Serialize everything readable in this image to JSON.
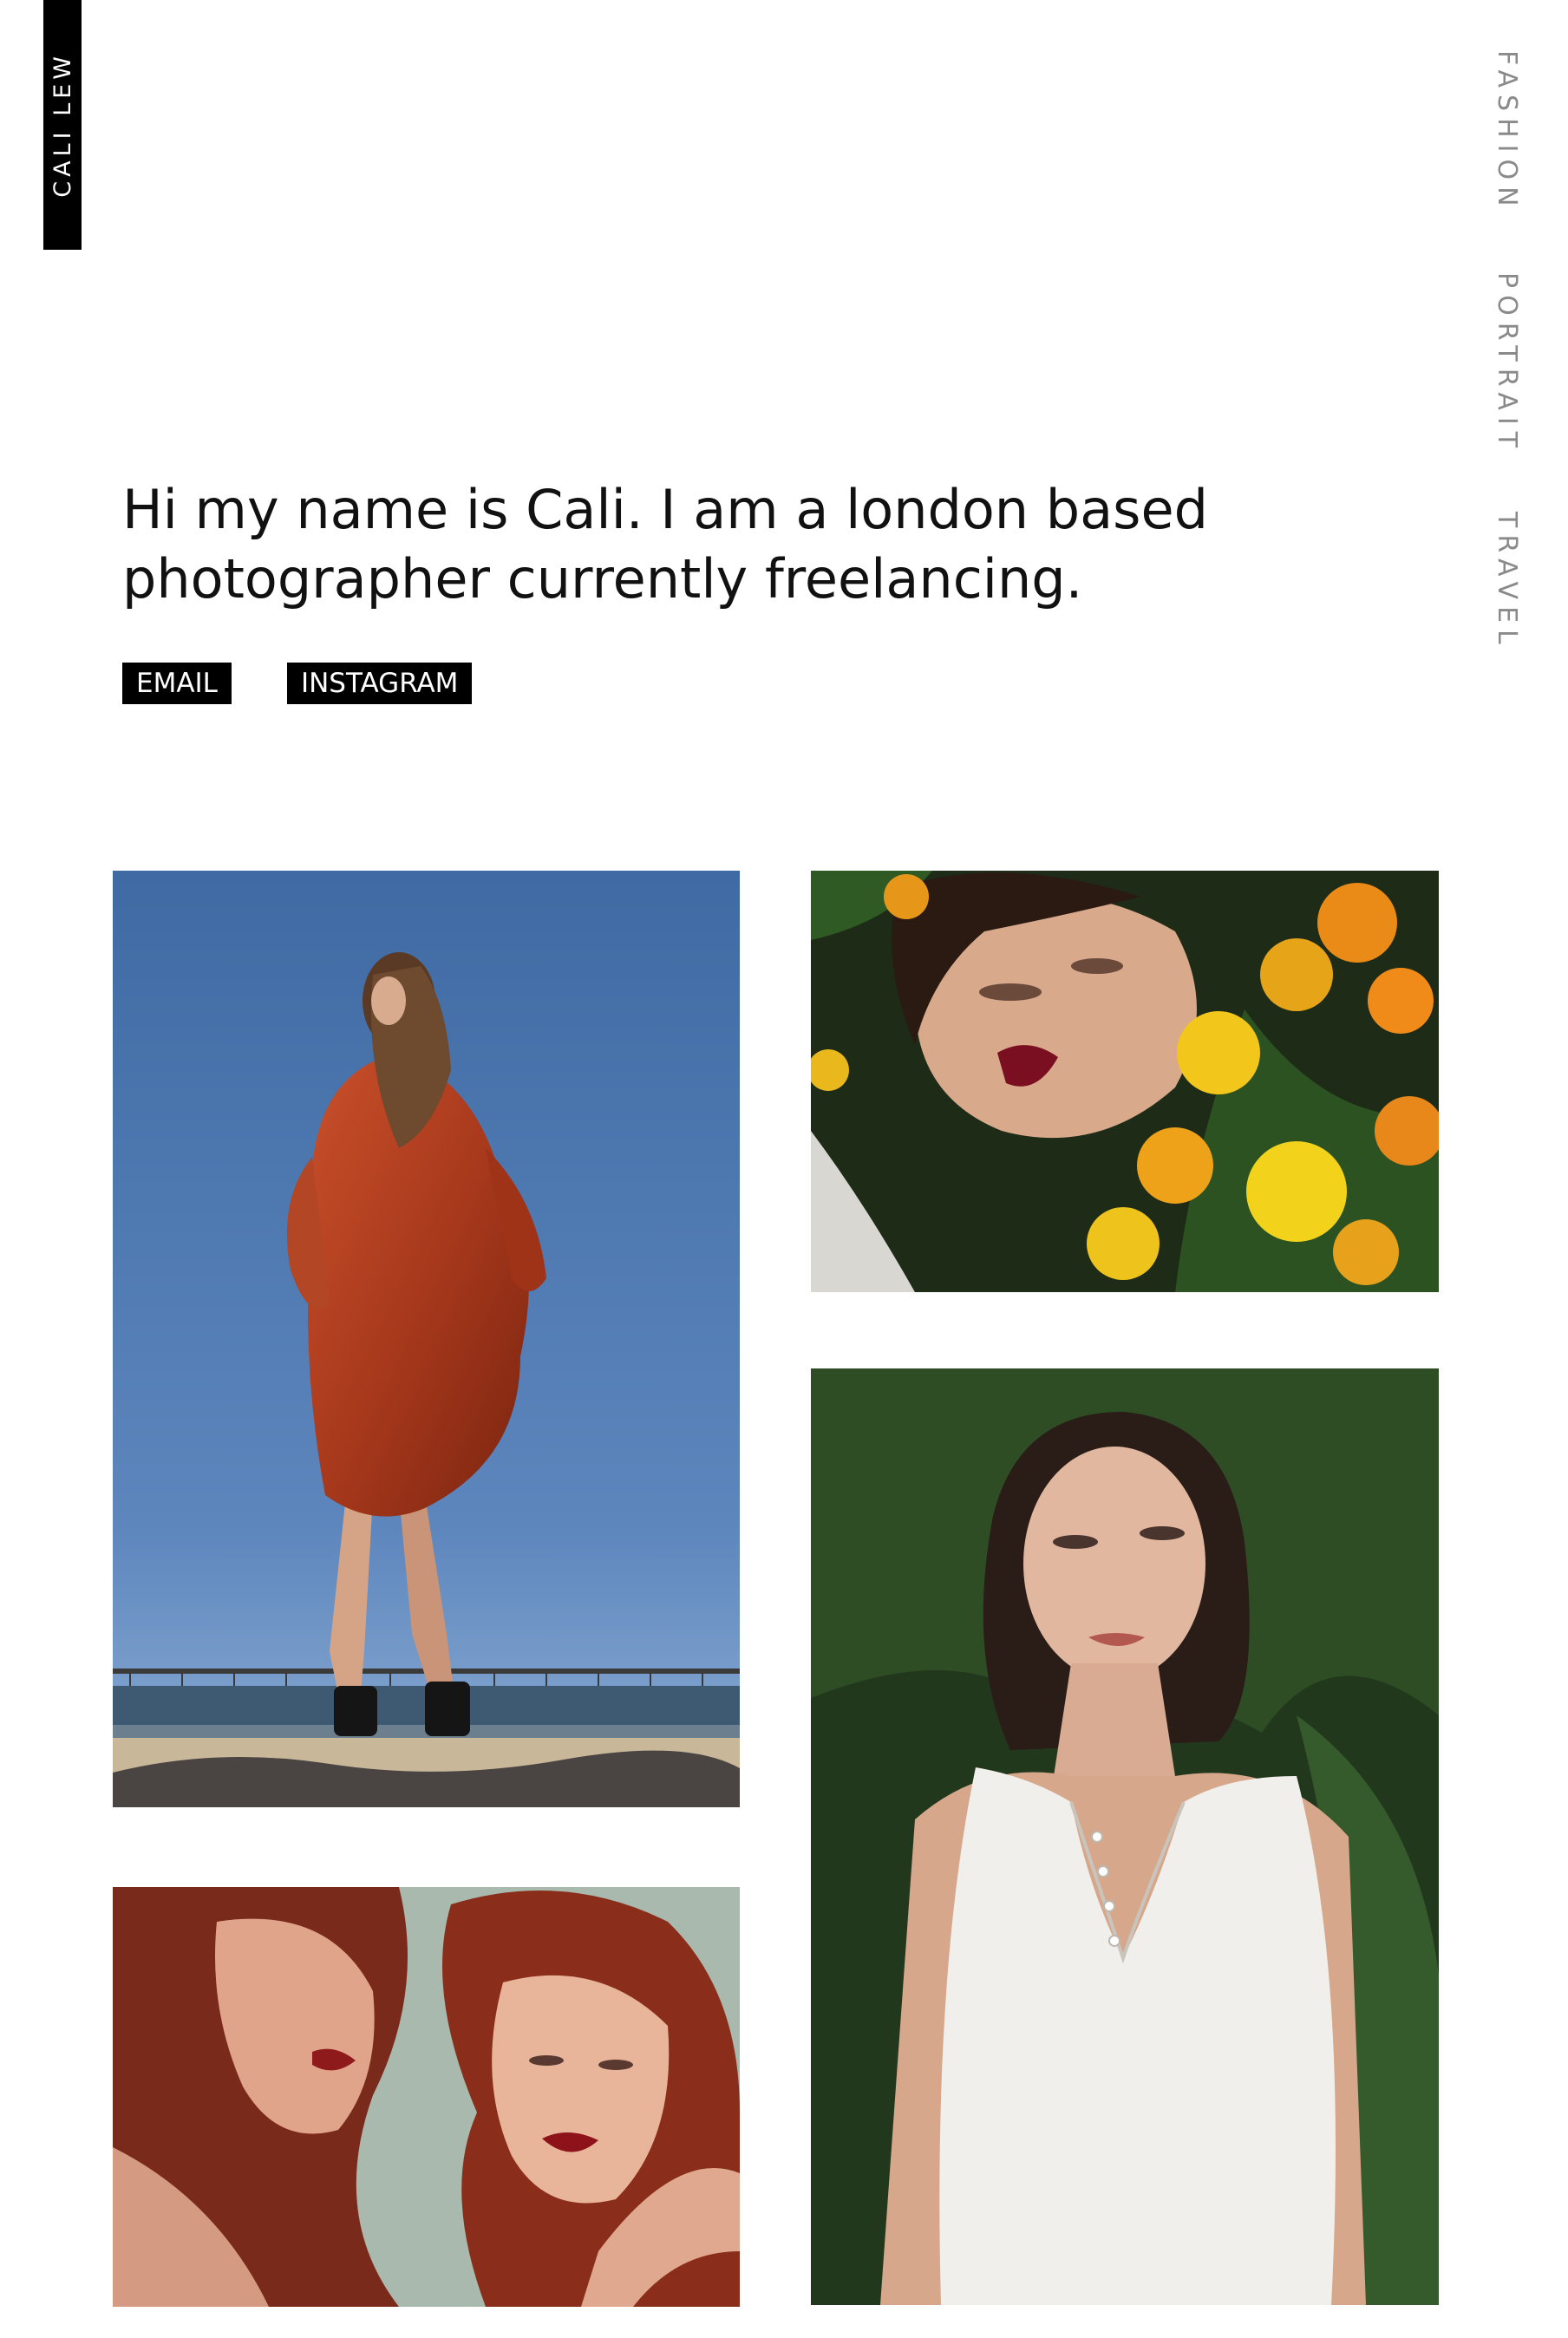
{
  "site": {
    "logo_text": "CALI LEW"
  },
  "nav": {
    "items": [
      {
        "label": "FASHION"
      },
      {
        "label": "PORTRAIT"
      },
      {
        "label": "TRAVEL"
      }
    ]
  },
  "intro": {
    "line1": "Hi my name is Cali. I am a london based",
    "line2": "photographer currently freelancing."
  },
  "links": {
    "email_label": "EMAIL",
    "instagram_label": "INSTAGRAM"
  },
  "gallery": {
    "photos": [
      {
        "subject": "woman in rust satin dress on rocks at the beach",
        "alt": "woman in rust satin dress on rocks at the beach"
      },
      {
        "subject": "woman lying among orange and yellow marigolds",
        "alt": "woman lying among orange and yellow marigolds"
      },
      {
        "subject": "woman in white sleeveless dress against green foliage",
        "alt": "woman in white sleeveless dress against green foliage"
      },
      {
        "subject": "two red curly haired women with red lips",
        "alt": "two red curly haired women with red lips"
      }
    ]
  },
  "colors": {
    "background": "#ffffff",
    "text": "#111111",
    "nav_text": "#8a8a8a",
    "button_bg": "#000000",
    "button_text": "#ffffff"
  }
}
